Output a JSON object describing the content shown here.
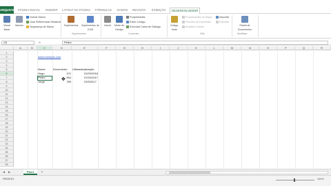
{
  "tabs": [
    "ARQUIVO",
    "PÁGINA INICIAL",
    "INSERIR",
    "LAYOUT DA PÁGINA",
    "FÓRMULAS",
    "DADOS",
    "REVISÃO",
    "EXIBIÇÃO",
    "DESENVOLVEDOR"
  ],
  "active_tab": "DESENVOLVEDOR",
  "ribbon": {
    "codigo": {
      "visual_basic": "Visual Basic",
      "macros": "Macros",
      "gravar_macro": "Gravar Macro",
      "usar_referencias": "Usar Referências Relativas",
      "seguranca_macro": "Segurança de Macro"
    },
    "suplementos": {
      "label": "Suplementos",
      "suplementos": "Suplementos",
      "suplementos_com": "Suplementos de COM"
    },
    "controles": {
      "label": "Controles",
      "inserir": "Inserir",
      "modo_design": "Modo de Design",
      "propriedades": "Propriedades",
      "exibir_codigo": "Exibir Código",
      "executar_caixa": "Executar Caixa de Diálogo"
    },
    "xml": {
      "label": "XML",
      "codigo_fonte": "Código-fonte",
      "propriedades_mapa": "Propriedades do Mapa",
      "pacotes_expansao": "Pacotes de Expansão",
      "atualizar_dados": "Atualizar Dados",
      "importar": "Importar",
      "exportar": "Exportar"
    },
    "modificar": {
      "label": "Modificar",
      "painel_documentos": "Painel de Documentos"
    }
  },
  "formula_bar": {
    "name_box": "C6",
    "fx": "fx",
    "value": "Pedro"
  },
  "columns": [
    "A",
    "B",
    "C",
    "D",
    "E",
    "F",
    "G",
    "H",
    "I",
    "J",
    "K",
    "L",
    "M",
    "N",
    "O",
    "P",
    "Q",
    "R",
    "S",
    "T"
  ],
  "rows": [
    "1",
    "2",
    "3",
    "4",
    "5",
    "6",
    "7",
    "8",
    "9",
    "10",
    "11",
    "12",
    "13",
    "14",
    "15",
    "16",
    "17",
    "18",
    "19",
    "20",
    "21",
    "22",
    "23",
    "24",
    "25",
    "26",
    "27",
    "28"
  ],
  "cells": {
    "link": "www.exemplo.com",
    "header_nome": "Nome",
    "header_documento": "Documento",
    "header_ultima": "Ultimaatualização",
    "r5": {
      "nome": "Hugo",
      "doc": "121",
      "data": "01/03/2016"
    },
    "r6": {
      "nome": "Pedro",
      "doc": "454",
      "data": "07/02/2017"
    },
    "r7": {
      "nome": "Jorge",
      "doc": "789",
      "data": "23/3/2017"
    }
  },
  "sheet": {
    "tab": "Plan1",
    "add": "+"
  },
  "status": {
    "ready": "PRONTO",
    "zoom": "100%"
  }
}
